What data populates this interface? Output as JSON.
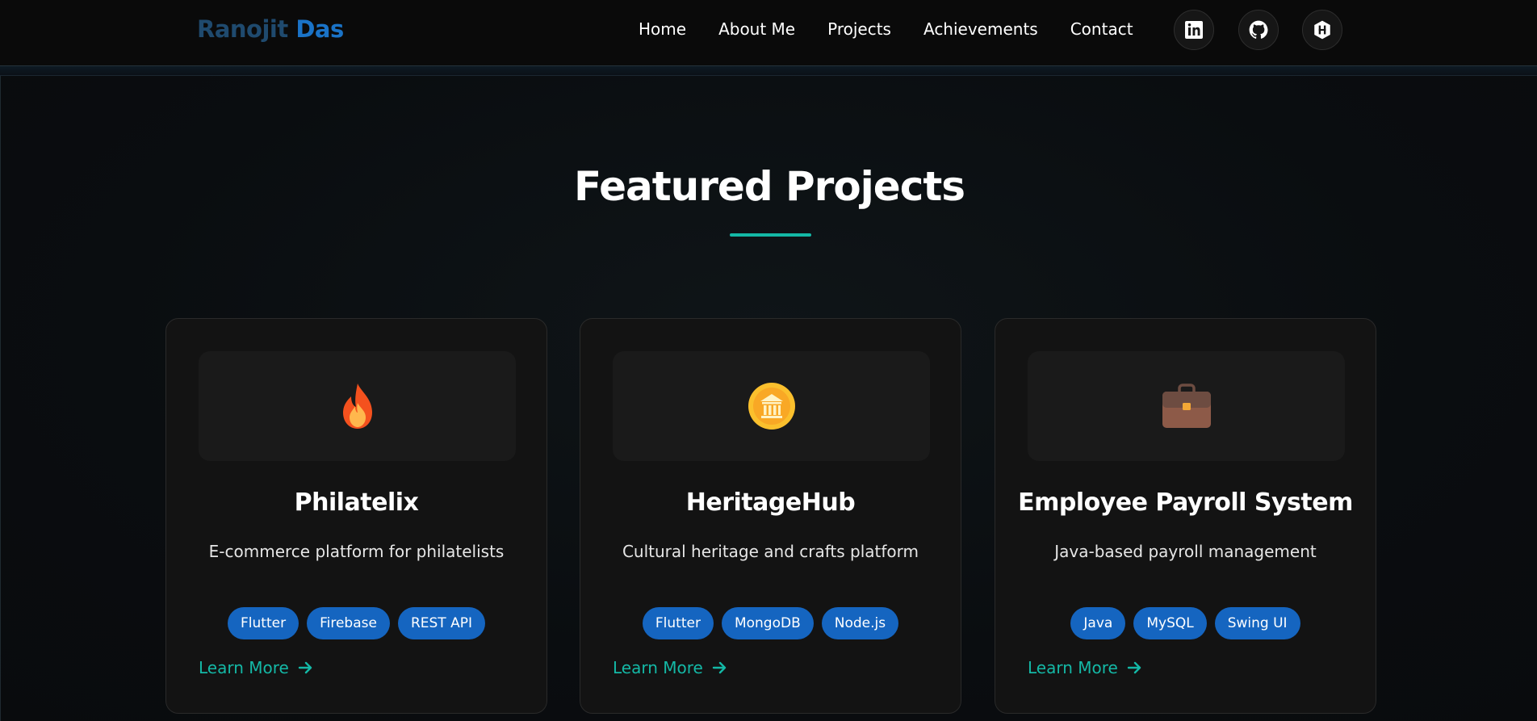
{
  "brand": {
    "first": "Ranojit",
    "last": "Das"
  },
  "nav": {
    "links": [
      "Home",
      "About Me",
      "Projects",
      "Achievements",
      "Contact"
    ],
    "social": [
      "linkedin-icon",
      "github-icon",
      "hashnode-icon"
    ]
  },
  "section": {
    "title": "Featured Projects"
  },
  "projects": [
    {
      "icon": "fire-icon",
      "title": "Philatelix",
      "description": "E-commerce platform for philatelists",
      "tags": [
        "Flutter",
        "Firebase",
        "REST API"
      ],
      "link": "Learn More"
    },
    {
      "icon": "museum-coin-icon",
      "title": "HeritageHub",
      "description": "Cultural heritage and crafts platform",
      "tags": [
        "Flutter",
        "MongoDB",
        "Node.js"
      ],
      "link": "Learn More"
    },
    {
      "icon": "briefcase-icon",
      "title": "Employee Payroll System",
      "description": "Java-based payroll management",
      "tags": [
        "Java",
        "MySQL",
        "Swing UI"
      ],
      "link": "Learn More"
    }
  ],
  "colors": {
    "accent": "#14b8a6",
    "tag": "#1565c0",
    "brand_dark": "#1f4a6e",
    "brand_light": "#1a73c7"
  }
}
